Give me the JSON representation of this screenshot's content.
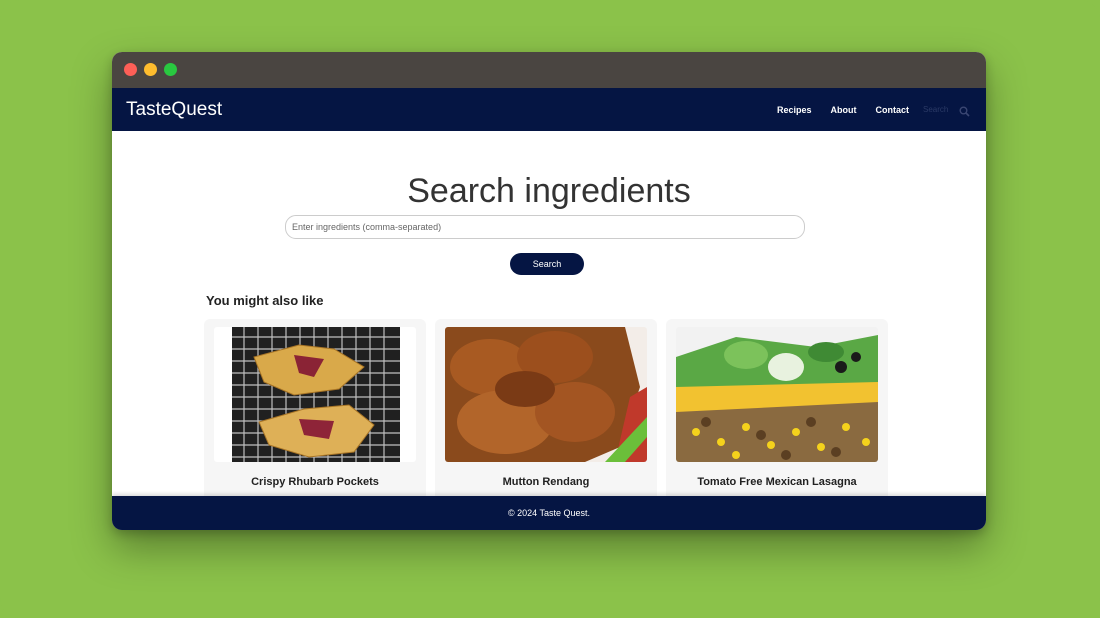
{
  "navbar": {
    "brand": "TasteQuest",
    "links": [
      "Recipes",
      "About",
      "Contact"
    ],
    "search_placeholder": "Search"
  },
  "main": {
    "title": "Search ingredients",
    "input_placeholder": "Enter ingredients (comma-separated)",
    "search_button": "Search",
    "section_title": "You might also like",
    "cards": [
      {
        "title": "Crispy Rhubarb Pockets"
      },
      {
        "title": "Mutton Rendang"
      },
      {
        "title": "Tomato Free Mexican Lasagna"
      }
    ]
  },
  "footer": {
    "text": "© 2024 Taste Quest."
  },
  "colors": {
    "background": "#8bc24a",
    "navbar": "#051543",
    "titlebar": "#4a4541"
  }
}
